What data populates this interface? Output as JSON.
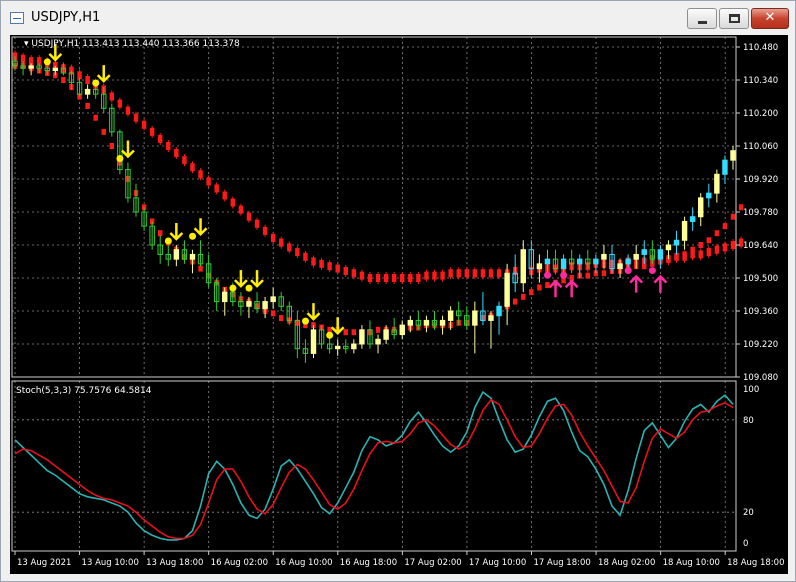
{
  "window": {
    "title": "USDJPY,H1"
  },
  "chart_data": [
    {
      "type": "candlestick",
      "title": "USDJPY,H1",
      "ohlc_label": "113.413 113.440 113.366 113.378",
      "ylim": [
        109.08,
        110.48
      ],
      "yticks": [
        "110.480",
        "110.340",
        "110.200",
        "110.060",
        "109.920",
        "109.780",
        "109.640",
        "109.500",
        "109.360",
        "109.220",
        "109.080"
      ],
      "grid": true,
      "series": [
        {
          "name": "candles",
          "color_up": "#ffff99",
          "color_down": "#33cc33",
          "values": [
            [
              110.42,
              110.44,
              110.38,
              110.4
            ],
            [
              110.4,
              110.42,
              110.36,
              110.39
            ],
            [
              110.39,
              110.41,
              110.36,
              110.4
            ],
            [
              110.4,
              110.41,
              110.37,
              110.39
            ],
            [
              110.39,
              110.4,
              110.36,
              110.38
            ],
            [
              110.38,
              110.4,
              110.36,
              110.39
            ],
            [
              110.39,
              110.41,
              110.36,
              110.37
            ],
            [
              110.37,
              110.38,
              110.3,
              110.33
            ],
            [
              110.33,
              110.35,
              110.27,
              110.28
            ],
            [
              110.28,
              110.32,
              110.26,
              110.3
            ],
            [
              110.3,
              110.33,
              110.26,
              110.28
            ],
            [
              110.28,
              110.31,
              110.2,
              110.22
            ],
            [
              110.22,
              110.24,
              110.1,
              110.12
            ],
            [
              110.12,
              110.13,
              109.94,
              109.96
            ],
            [
              109.96,
              109.99,
              109.82,
              109.84
            ],
            [
              109.84,
              109.9,
              109.76,
              109.78
            ],
            [
              109.78,
              109.8,
              109.7,
              109.72
            ],
            [
              109.72,
              109.74,
              109.62,
              109.64
            ],
            [
              109.64,
              109.68,
              109.56,
              109.6
            ],
            [
              109.6,
              109.64,
              109.55,
              109.58
            ],
            [
              109.58,
              109.64,
              109.55,
              109.62
            ],
            [
              109.62,
              109.66,
              109.56,
              109.58
            ],
            [
              109.58,
              109.62,
              109.52,
              109.6
            ],
            [
              109.6,
              109.66,
              109.55,
              109.56
            ],
            [
              109.56,
              109.6,
              109.46,
              109.48
            ],
            [
              109.48,
              109.5,
              109.36,
              109.4
            ],
            [
              109.4,
              109.46,
              109.34,
              109.44
            ],
            [
              109.44,
              109.48,
              109.38,
              109.4
            ],
            [
              109.4,
              109.44,
              109.34,
              109.38
            ],
            [
              109.38,
              109.42,
              109.33,
              109.4
            ],
            [
              109.4,
              109.44,
              109.35,
              109.37
            ],
            [
              109.37,
              109.42,
              109.33,
              109.4
            ],
            [
              109.4,
              109.46,
              109.37,
              109.42
            ],
            [
              109.42,
              109.44,
              109.36,
              109.38
            ],
            [
              109.38,
              109.4,
              109.3,
              109.32
            ],
            [
              109.32,
              109.36,
              109.16,
              109.2
            ],
            [
              109.2,
              109.24,
              109.14,
              109.18
            ],
            [
              109.18,
              109.3,
              109.16,
              109.28
            ],
            [
              109.28,
              109.3,
              109.2,
              109.22
            ],
            [
              109.22,
              109.26,
              109.18,
              109.2
            ],
            [
              109.2,
              109.24,
              109.17,
              109.21
            ],
            [
              109.21,
              109.24,
              109.18,
              109.2
            ],
            [
              109.2,
              109.24,
              109.18,
              109.22
            ],
            [
              109.22,
              109.3,
              109.2,
              109.28
            ],
            [
              109.28,
              109.32,
              109.2,
              109.22
            ],
            [
              109.22,
              109.26,
              109.18,
              109.24
            ],
            [
              109.24,
              109.3,
              109.22,
              109.28
            ],
            [
              109.28,
              109.33,
              109.24,
              109.26
            ],
            [
              109.26,
              109.32,
              109.24,
              109.3
            ],
            [
              109.3,
              109.34,
              109.27,
              109.32
            ],
            [
              109.32,
              109.36,
              109.28,
              109.3
            ],
            [
              109.3,
              109.34,
              109.27,
              109.32
            ],
            [
              109.32,
              109.36,
              109.28,
              109.3
            ],
            [
              109.3,
              109.34,
              109.26,
              109.32
            ],
            [
              109.32,
              109.38,
              109.28,
              109.36
            ],
            [
              109.36,
              109.4,
              109.3,
              109.34
            ],
            [
              109.34,
              109.38,
              109.28,
              109.3
            ],
            [
              109.3,
              109.4,
              109.18,
              109.36
            ],
            [
              109.36,
              109.44,
              109.3,
              109.32
            ],
            [
              109.32,
              109.36,
              109.2,
              109.34
            ],
            [
              109.34,
              109.4,
              109.26,
              109.38
            ],
            [
              109.38,
              109.56,
              109.3,
              109.52
            ],
            [
              109.52,
              109.6,
              109.44,
              109.48
            ],
            [
              109.48,
              109.66,
              109.44,
              109.62
            ],
            [
              109.62,
              109.66,
              109.5,
              109.54
            ],
            [
              109.54,
              109.6,
              109.48,
              109.56
            ],
            [
              109.56,
              109.62,
              109.5,
              109.58
            ],
            [
              109.58,
              109.62,
              109.52,
              109.54
            ],
            [
              109.54,
              109.6,
              109.5,
              109.58
            ],
            [
              109.58,
              109.62,
              109.52,
              109.56
            ],
            [
              109.56,
              109.6,
              109.5,
              109.58
            ],
            [
              109.58,
              109.62,
              109.54,
              109.56
            ],
            [
              109.56,
              109.6,
              109.52,
              109.58
            ],
            [
              109.58,
              109.64,
              109.54,
              109.6
            ],
            [
              109.6,
              109.64,
              109.52,
              109.54
            ],
            [
              109.54,
              109.58,
              109.5,
              109.56
            ],
            [
              109.56,
              109.6,
              109.52,
              109.58
            ],
            [
              109.58,
              109.64,
              109.54,
              109.6
            ],
            [
              109.6,
              109.66,
              109.56,
              109.62
            ],
            [
              109.62,
              109.66,
              109.56,
              109.58
            ],
            [
              109.58,
              109.64,
              109.54,
              109.62
            ],
            [
              109.62,
              109.66,
              109.58,
              109.64
            ],
            [
              109.64,
              109.7,
              109.6,
              109.66
            ],
            [
              109.66,
              109.76,
              109.62,
              109.74
            ],
            [
              109.74,
              109.8,
              109.7,
              109.76
            ],
            [
              109.76,
              109.86,
              109.72,
              109.84
            ],
            [
              109.84,
              109.9,
              109.8,
              109.86
            ],
            [
              109.86,
              109.96,
              109.82,
              109.94
            ],
            [
              109.94,
              110.02,
              109.9,
              110.0
            ],
            [
              110.0,
              110.06,
              109.96,
              110.04
            ]
          ]
        },
        {
          "name": "ma",
          "color": "#ff1a1a",
          "values": [
            110.44,
            110.43,
            110.42,
            110.42,
            110.41,
            110.4,
            110.39,
            110.38,
            110.36,
            110.34,
            110.32,
            110.3,
            110.27,
            110.24,
            110.21,
            110.18,
            110.15,
            110.12,
            110.09,
            110.06,
            110.03,
            110.0,
            109.97,
            109.94,
            109.91,
            109.88,
            109.85,
            109.82,
            109.79,
            109.76,
            109.73,
            109.7,
            109.67,
            109.65,
            109.63,
            109.61,
            109.59,
            109.57,
            109.56,
            109.55,
            109.54,
            109.53,
            109.52,
            109.51,
            109.5,
            109.5,
            109.5,
            109.5,
            109.5,
            109.5,
            109.5,
            109.51,
            109.51,
            109.51,
            109.52,
            109.52,
            109.52,
            109.52,
            109.52,
            109.52,
            109.52,
            109.52,
            109.53,
            109.53,
            109.53,
            109.54,
            109.54,
            109.54,
            109.54,
            109.55,
            109.55,
            109.55,
            109.56,
            109.56,
            109.56,
            109.56,
            109.57,
            109.57,
            109.57,
            109.58,
            109.58,
            109.58,
            109.59,
            109.59,
            109.6,
            109.6,
            109.61,
            109.62,
            109.63,
            109.64,
            109.65
          ]
        },
        {
          "name": "envelope",
          "color": "#ff1a1a",
          "values": [
            110.4,
            110.4,
            110.39,
            110.38,
            110.37,
            110.36,
            110.34,
            110.31,
            110.27,
            110.23,
            110.18,
            110.12,
            110.06,
            109.99,
            109.92,
            109.86,
            109.8,
            109.74,
            109.69,
            109.65,
            109.62,
            109.59,
            109.57,
            109.54,
            109.51,
            109.48,
            109.45,
            109.43,
            109.41,
            109.4,
            109.38,
            109.36,
            109.35,
            109.33,
            109.32,
            109.31,
            109.3,
            109.3,
            109.29,
            109.28,
            109.28,
            109.27,
            109.27,
            109.27,
            109.27,
            109.28,
            109.28,
            109.28,
            109.29,
            109.29,
            109.29,
            109.3,
            109.3,
            109.3,
            109.3,
            109.31,
            109.31,
            109.32,
            109.33,
            109.34,
            109.36,
            109.38,
            109.4,
            109.42,
            109.44,
            109.46,
            109.47,
            109.48,
            109.49,
            109.5,
            109.51,
            109.51,
            109.52,
            109.52,
            109.53,
            109.53,
            109.54,
            109.55,
            109.55,
            109.56,
            109.57,
            109.58,
            109.59,
            109.6,
            109.62,
            109.64,
            109.66,
            109.69,
            109.72,
            109.76,
            109.8
          ]
        }
      ]
    },
    {
      "type": "line",
      "title": "Stoch(5,3,3) 75.7576 64.5814",
      "ylim": [
        0,
        100
      ],
      "yticks": [
        "100",
        "80",
        "20",
        "0"
      ],
      "grid": true,
      "series": [
        {
          "name": "main",
          "color": "#2bb3b3",
          "values": [
            67,
            62,
            57,
            52,
            47,
            44,
            40,
            36,
            32,
            30,
            29,
            28,
            26,
            24,
            20,
            13,
            8,
            5,
            3,
            2,
            2,
            3,
            8,
            24,
            45,
            53,
            48,
            38,
            26,
            18,
            16,
            22,
            35,
            50,
            54,
            48,
            40,
            32,
            23,
            19,
            26,
            36,
            46,
            60,
            69,
            67,
            63,
            65,
            70,
            79,
            85,
            78,
            70,
            63,
            59,
            63,
            72,
            88,
            98,
            94,
            80,
            67,
            59,
            61,
            70,
            82,
            92,
            94,
            86,
            72,
            60,
            56,
            48,
            38,
            24,
            18,
            34,
            55,
            73,
            78,
            70,
            62,
            68,
            79,
            87,
            90,
            85,
            92,
            96,
            90
          ]
        },
        {
          "name": "signal",
          "color": "#e8101a",
          "values": [
            58,
            61,
            60,
            57,
            54,
            50,
            46,
            42,
            38,
            34,
            31,
            29,
            28,
            26,
            24,
            20,
            15,
            11,
            7,
            4,
            3,
            3,
            5,
            12,
            26,
            41,
            48,
            48,
            40,
            30,
            22,
            19,
            25,
            36,
            46,
            51,
            48,
            41,
            33,
            25,
            22,
            26,
            35,
            47,
            58,
            65,
            66,
            65,
            66,
            71,
            78,
            80,
            76,
            70,
            64,
            61,
            64,
            74,
            86,
            93,
            90,
            80,
            69,
            62,
            63,
            71,
            81,
            89,
            90,
            83,
            72,
            63,
            55,
            47,
            37,
            27,
            26,
            36,
            53,
            68,
            74,
            71,
            68,
            72,
            80,
            85,
            86,
            89,
            91,
            88
          ]
        }
      ],
      "categories": [
        "13 Aug 2021",
        "13 Aug 10:00",
        "13 Aug 18:00",
        "16 Aug 02:00",
        "16 Aug 10:00",
        "16 Aug 18:00",
        "17 Aug 02:00",
        "17 Aug 10:00",
        "17 Aug 18:00",
        "18 Aug 02:00",
        "18 Aug 10:00",
        "18 Aug 18:00"
      ]
    }
  ],
  "signals": {
    "sell_arrows": [
      5,
      11,
      14,
      20,
      23,
      28,
      30,
      37,
      40
    ],
    "buy_arrows": [
      67,
      69,
      77,
      80
    ]
  },
  "colors": {
    "background": "#000000",
    "grid": "#8a8a8a",
    "axis_text": "#ffffff",
    "sell_signal": "#ffee00",
    "buy_signal": "#ff2aa0",
    "up_trend_candle": "#33ddff"
  }
}
